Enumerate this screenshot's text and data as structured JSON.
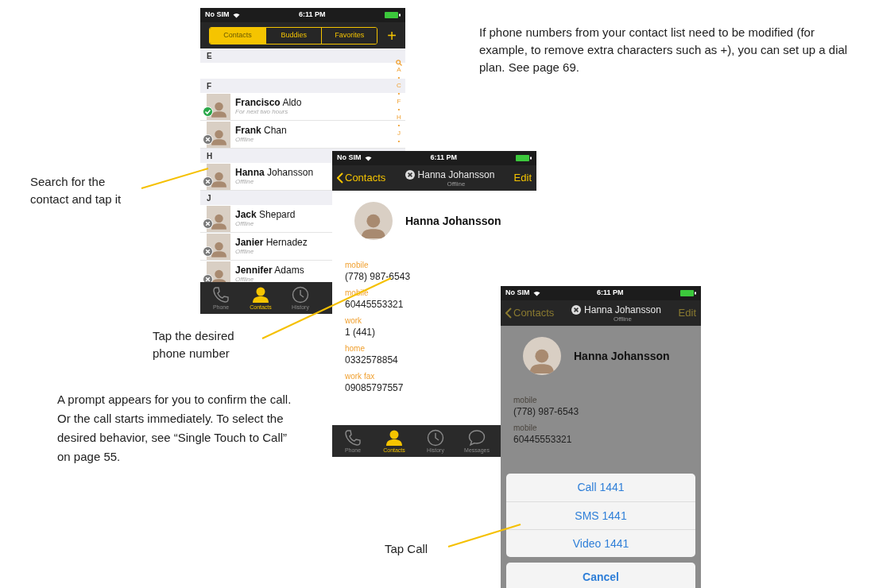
{
  "callouts": [
    {
      "text": "If phone numbers from your contact list need to be modified (for example, to remove extra characters such as +), you can set up a dial plan. See page 69."
    },
    {
      "text": "Search for the contact and tap it"
    },
    {
      "text": "Tap the desired phone number"
    },
    {
      "text": "A prompt appears for you to confirm the call. Or the call starts immediately. To select the desired behavior, see “Single Touch to Call” on page 55."
    },
    {
      "text": "Tap Call"
    }
  ],
  "contact_list_screen": {
    "status_bar": {
      "carrier": "No SIM",
      "time": "6:11 PM"
    },
    "segments": [
      {
        "label": "Contacts",
        "selected": true
      },
      {
        "label": "Buddies",
        "selected": false
      },
      {
        "label": "Favorites",
        "selected": false
      }
    ],
    "add_button": "+",
    "sections": [
      {
        "letter": "E"
      },
      {
        "letter": "F",
        "contacts": [
          {
            "first": "Francisco",
            "last": "Aldo",
            "available": true,
            "note": "For next two hours"
          },
          {
            "first": "Frank",
            "last": "Chan",
            "available": false,
            "note": "Offline"
          }
        ]
      },
      {
        "letter": "H",
        "contacts": [
          {
            "first": "Hanna",
            "last": "Johansson",
            "available": false,
            "note": "Offline"
          }
        ]
      },
      {
        "letter": "J",
        "contacts": [
          {
            "first": "Jack",
            "last": "Shepard",
            "available": false,
            "note": "Offline"
          },
          {
            "first": "Janier",
            "last": "Hernadez",
            "available": false,
            "note": "Offline"
          },
          {
            "first": "Jennifer",
            "last": "Adams",
            "available": false,
            "note": "Offline"
          }
        ]
      }
    ],
    "index": [
      "A",
      "•",
      "C",
      "•",
      "F",
      "•",
      "H",
      "•",
      "J",
      "•"
    ],
    "tab_bar": [
      {
        "label": "Phone",
        "selected": false
      },
      {
        "label": "Contacts",
        "selected": true
      },
      {
        "label": "History",
        "selected": false
      }
    ]
  },
  "contact_detail_screen": {
    "status_bar": {
      "carrier": "No SIM",
      "time": "6:11 PM"
    },
    "nav": {
      "back": "Contacts",
      "title": "Hanna Johansson",
      "subtitle": "Offline",
      "edit": "Edit"
    },
    "name": "Hanna Johansson",
    "fields": [
      {
        "label": "mobile",
        "value": "(778) 987-6543"
      },
      {
        "label": "mobile",
        "value": "60445553321"
      },
      {
        "label": "work",
        "value": "1 (441)"
      },
      {
        "label": "home",
        "value": "0332578854"
      },
      {
        "label": "work fax",
        "value": "09085797557"
      }
    ],
    "tab_bar": [
      {
        "label": "Phone",
        "selected": false
      },
      {
        "label": "Contacts",
        "selected": true
      },
      {
        "label": "History",
        "selected": false
      },
      {
        "label": "Messages",
        "selected": false
      }
    ]
  },
  "call_prompt_screen": {
    "status_bar": {
      "carrier": "No SIM",
      "time": "6:11 PM"
    },
    "nav": {
      "back": "Contacts",
      "title": "Hanna Johansson",
      "subtitle": "Offline",
      "edit": "Edit"
    },
    "name": "Hanna Johansson",
    "fields": [
      {
        "label": "mobile",
        "value": "(778) 987-6543"
      },
      {
        "label": "mobile",
        "value": "60445553321"
      }
    ],
    "action_sheet": {
      "actions": [
        "Call 1441",
        "SMS 1441",
        "Video 1441"
      ],
      "cancel": "Cancel"
    }
  }
}
